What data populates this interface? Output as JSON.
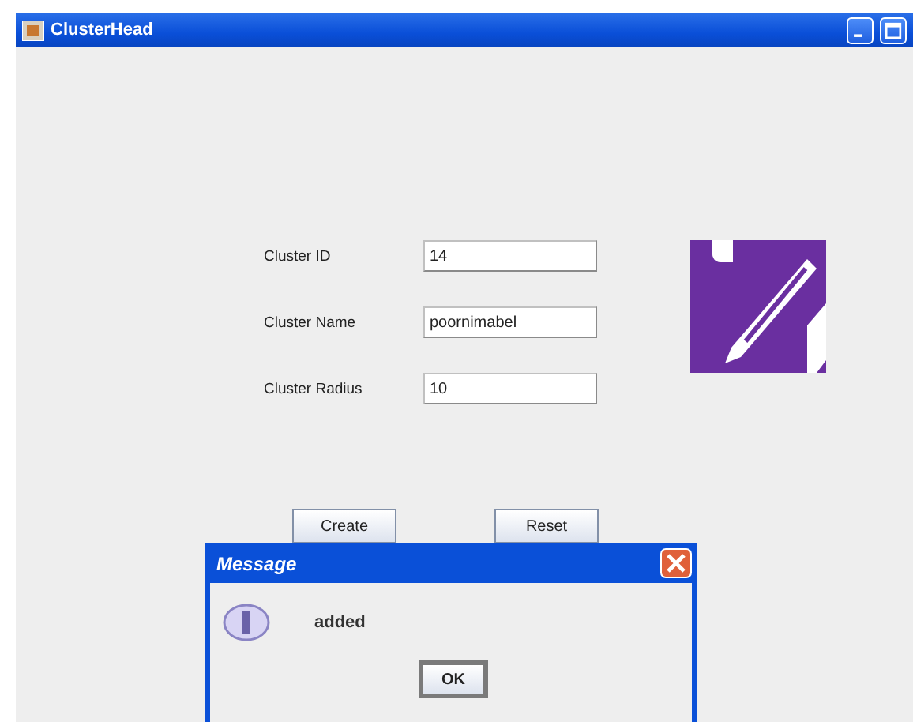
{
  "window": {
    "title": "ClusterHead"
  },
  "fields": [
    {
      "label": "Cluster ID",
      "value": "14"
    },
    {
      "label": "Cluster Name",
      "value": "poornimabel"
    },
    {
      "label": "Cluster Radius",
      "value": "10"
    }
  ],
  "buttons": [
    "Create",
    "Reset"
  ],
  "dialog": {
    "title": "Message",
    "message": "added",
    "button": "OK"
  }
}
